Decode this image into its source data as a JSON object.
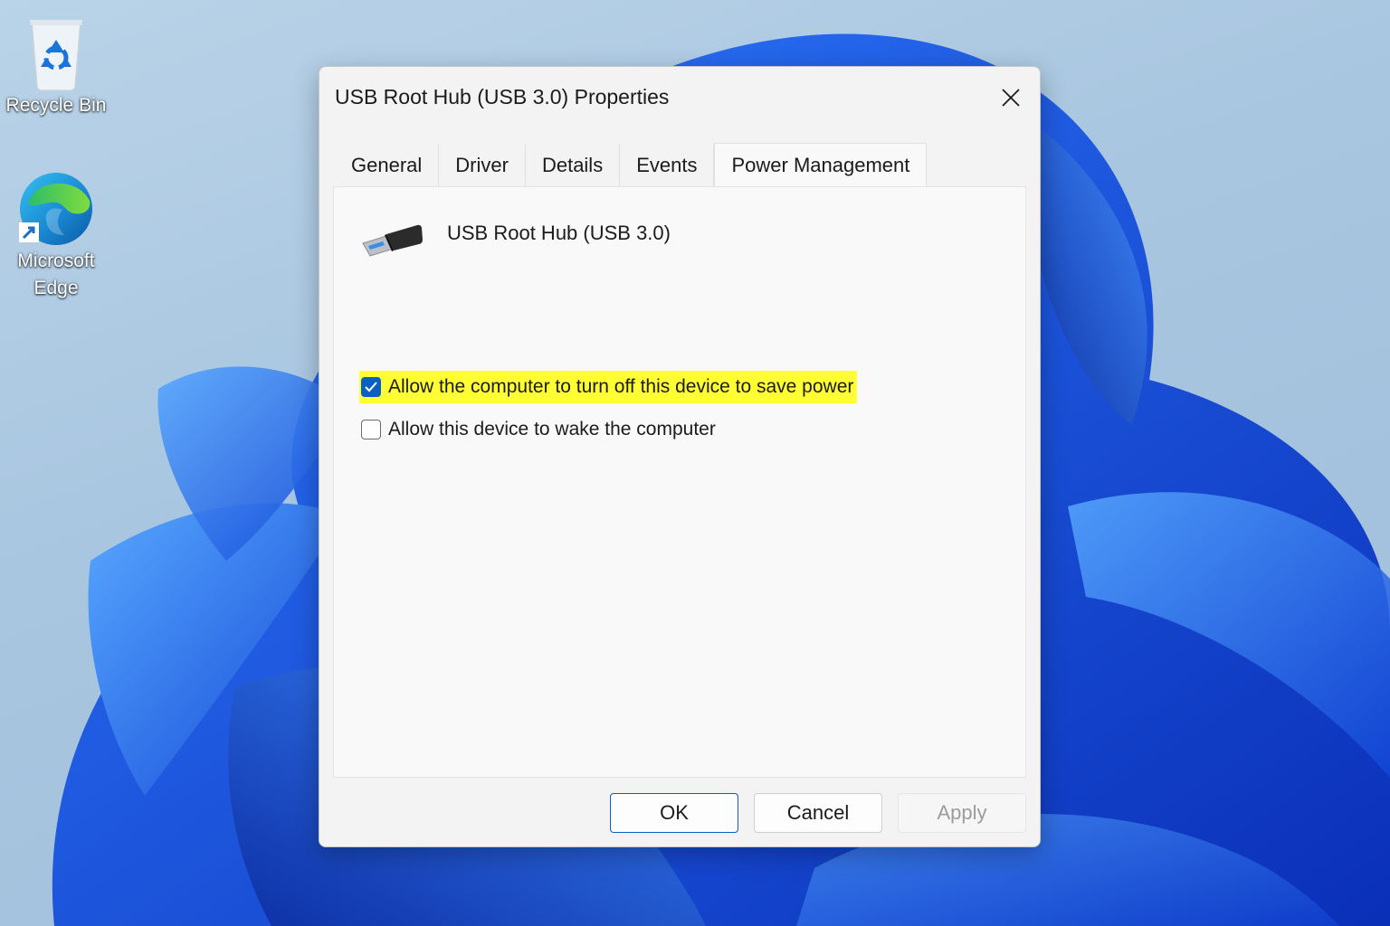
{
  "desktop": {
    "icons": [
      {
        "label": "Recycle Bin",
        "icon": "recycle-bin-icon"
      },
      {
        "label_line1": "Microsoft",
        "label_line2": "Edge",
        "icon": "microsoft-edge-icon"
      }
    ]
  },
  "dialog": {
    "title": "USB Root Hub (USB 3.0) Properties",
    "tabs": [
      {
        "label": "General"
      },
      {
        "label": "Driver"
      },
      {
        "label": "Details"
      },
      {
        "label": "Events"
      },
      {
        "label": "Power Management",
        "active": true
      }
    ],
    "device_name": "USB Root Hub (USB 3.0)",
    "device_icon": "usb-connector-icon",
    "options": [
      {
        "label": "Allow the computer to turn off this device to save power",
        "checked": true,
        "highlighted": true
      },
      {
        "label": "Allow this device to wake the computer",
        "checked": false
      }
    ],
    "buttons": {
      "ok": "OK",
      "cancel": "Cancel",
      "apply": "Apply"
    }
  },
  "colors": {
    "accent": "#0a5fc2",
    "highlight": "#ffff33",
    "wallpaper_blue": "#1a5ff0"
  }
}
